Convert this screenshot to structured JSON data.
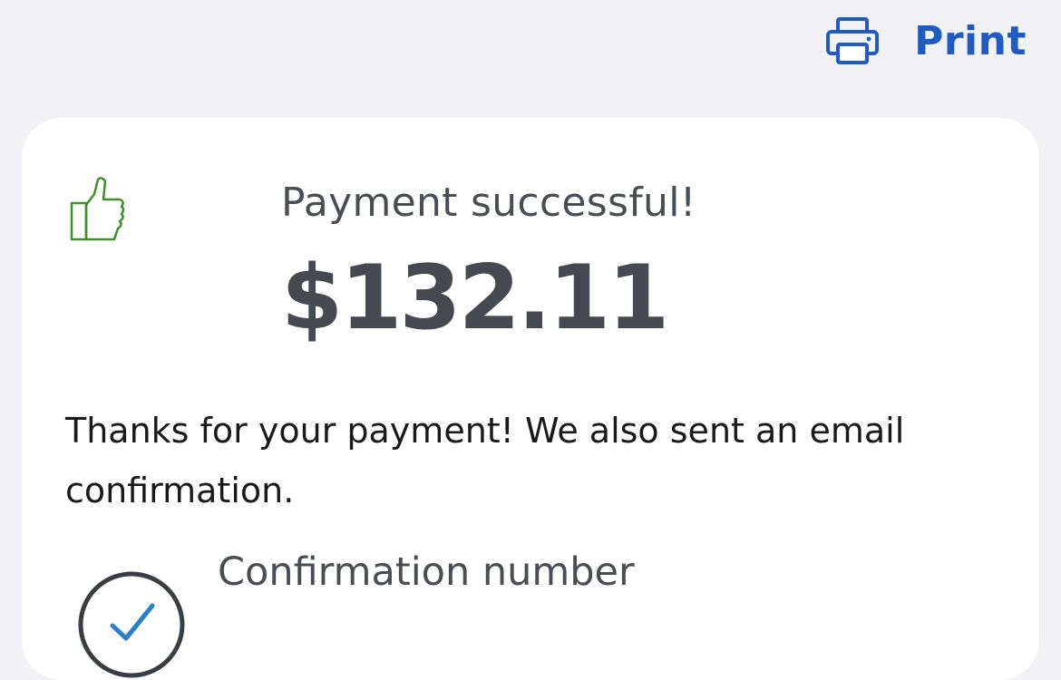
{
  "header": {
    "print_label": "Print",
    "print_icon": "printer-icon",
    "accent_color": "#1f5bc0"
  },
  "card": {
    "status_icon": "thumbs-up-icon",
    "status_icon_color": "#3f8f2b",
    "status_text": "Payment successful!",
    "amount": "$132.11",
    "message": "Thanks for your payment! We also sent an email confirmation.",
    "confirmation": {
      "icon": "check-circle-icon",
      "label": "Confirmation number"
    }
  }
}
